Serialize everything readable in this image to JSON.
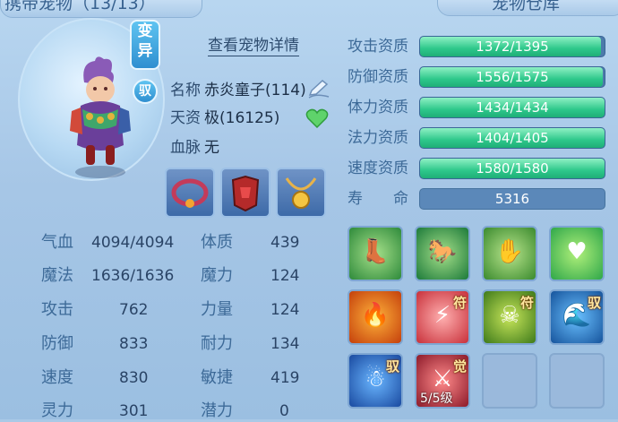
{
  "header": {
    "left_title": "携带宠物（13/13）",
    "right_title": "宠物仓库"
  },
  "pet": {
    "mutation_badge": "变异",
    "ride_badge": "驭",
    "detail_link": "查看宠物详情",
    "name_label": "名称",
    "name_value": "赤炎童子(114)",
    "talent_label": "天资",
    "talent_value": "极(16125)",
    "bloodline_label": "血脉",
    "bloodline_value": "无"
  },
  "stats": [
    {
      "label": "气血",
      "value": "4094/4094",
      "label2": "体质",
      "value2": "439"
    },
    {
      "label": "魔法",
      "value": "1636/1636",
      "label2": "魔力",
      "value2": "124"
    },
    {
      "label": "攻击",
      "value": "762",
      "label2": "力量",
      "value2": "124"
    },
    {
      "label": "防御",
      "value": "833",
      "label2": "耐力",
      "value2": "134"
    },
    {
      "label": "速度",
      "value": "830",
      "label2": "敏捷",
      "value2": "419"
    },
    {
      "label": "灵力",
      "value": "301",
      "label2": "潜力",
      "value2": "0"
    }
  ],
  "aptitudes": [
    {
      "label": "攻击资质",
      "text": "1372/1395",
      "fraction": 0.983
    },
    {
      "label": "防御资质",
      "text": "1556/1575",
      "fraction": 0.988
    },
    {
      "label": "体力资质",
      "text": "1434/1434",
      "fraction": 1.0
    },
    {
      "label": "法力资质",
      "text": "1404/1405",
      "fraction": 0.999
    },
    {
      "label": "速度资质",
      "text": "1580/1580",
      "fraction": 1.0
    }
  ],
  "life": {
    "label": "寿　　命",
    "value": "5316"
  },
  "skills": [
    {
      "icon": "boot-skill-icon",
      "tag": "",
      "level": ""
    },
    {
      "icon": "horse-skill-icon",
      "tag": "",
      "level": ""
    },
    {
      "icon": "hand-flame-skill-icon",
      "tag": "",
      "level": ""
    },
    {
      "icon": "heart-skill-icon",
      "tag": "",
      "level": ""
    },
    {
      "icon": "fire-gourd-skill-icon",
      "tag": "",
      "level": ""
    },
    {
      "icon": "lightning-orb-skill-icon",
      "tag": "符",
      "level": ""
    },
    {
      "icon": "demon-mask-skill-icon",
      "tag": "符",
      "level": ""
    },
    {
      "icon": "water-beast-skill-icon",
      "tag": "驭",
      "level": ""
    },
    {
      "icon": "blue-demon-skill-icon",
      "tag": "驭",
      "level": ""
    },
    {
      "icon": "red-warrior-skill-icon",
      "tag": "觉",
      "level": "5/5级"
    }
  ],
  "colors": {
    "accent": "#2ec88b",
    "bar_bg": "#4d7aab",
    "label": "#3d6a98"
  }
}
